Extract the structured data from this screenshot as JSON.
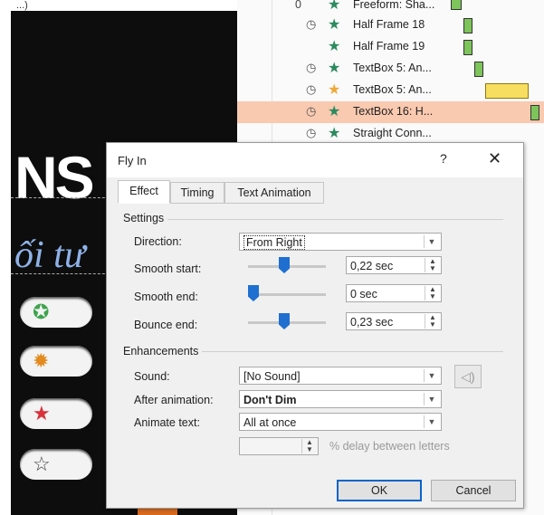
{
  "slide": {
    "top_text": "...)",
    "heading_fragment": "NS",
    "script_text": "ối tư"
  },
  "animation_pane": {
    "rows": [
      {
        "number": "0",
        "clock": false,
        "star": "green",
        "name": "Freeform: Sha..."
      },
      {
        "number": "",
        "clock": true,
        "star": "green",
        "name": "Half Frame 18"
      },
      {
        "number": "",
        "clock": false,
        "star": "green",
        "name": "Half Frame 19"
      },
      {
        "number": "",
        "clock": true,
        "star": "green",
        "name": "TextBox 5: An..."
      },
      {
        "number": "",
        "clock": true,
        "star": "gold",
        "name": "TextBox 5: An..."
      },
      {
        "number": "",
        "clock": true,
        "star": "green",
        "name": "TextBox 16: H...",
        "selected": true
      },
      {
        "number": "",
        "clock": true,
        "star": "green",
        "name": "Straight Conn..."
      }
    ]
  },
  "dialog": {
    "title": "Fly In",
    "help": "?",
    "close": "✕",
    "tabs": [
      "Effect",
      "Timing",
      "Text Animation"
    ],
    "settings": {
      "label": "Settings",
      "direction_label": "Direction:",
      "direction_value": "From Right",
      "smooth_start_label": "Smooth start:",
      "smooth_start_value": "0,22 sec",
      "smooth_end_label": "Smooth end:",
      "smooth_end_value": "0 sec",
      "bounce_end_label": "Bounce end:",
      "bounce_end_value": "0,23 sec"
    },
    "enhancements": {
      "label": "Enhancements",
      "sound_label": "Sound:",
      "sound_value": "[No Sound]",
      "after_label": "After animation:",
      "after_value": "Don't Dim",
      "animate_text_label": "Animate text:",
      "animate_text_value": "All at once",
      "delay_value": "",
      "delay_label": "% delay between letters"
    },
    "ok": "OK",
    "cancel": "Cancel"
  }
}
